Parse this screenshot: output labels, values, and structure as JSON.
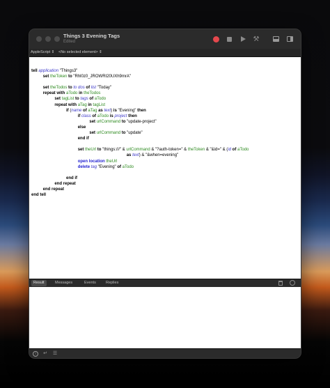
{
  "window": {
    "title": "Things 3 Evening Tags",
    "status": "Edited"
  },
  "toolbar": {
    "record_icon": "record-icon",
    "stop_icon": "stop-icon",
    "run_icon": "run-icon",
    "compile_icon": "hammer-icon",
    "colors": {
      "record": "#e5484d"
    }
  },
  "navbar": {
    "language": "AppleScript ⇕",
    "element": "<No selected element> ⇕"
  },
  "code": {
    "l1_a": "tell",
    "l1_b": "application",
    "l1_c": " \"Things3\"",
    "l2_a": "set",
    "l2_b": "theToken",
    "l2_c": "to",
    "l2_d": " \"Rhl0z0_JROWRI20UXh9mrA\"",
    "l4_a": "set",
    "l4_b": "theTodos",
    "l4_c": "to",
    "l4_d": "to dos",
    "l4_e": "of",
    "l4_f": "list",
    "l4_g": " \"Today\"",
    "l5_a": "repeat with",
    "l5_b": "aTodo",
    "l5_c": "in",
    "l5_d": "theTodos",
    "l6_a": "set",
    "l6_b": "tagList",
    "l6_c": "to",
    "l6_d": "tags",
    "l6_e": "of",
    "l6_f": "aTodo",
    "l7_a": "repeat with",
    "l7_b": "aTag",
    "l7_c": "in",
    "l7_d": "tagList",
    "l8_a": "if",
    "l8_b": " (",
    "l8_c": "name",
    "l8_d": "of",
    "l8_e": "aTag",
    "l8_f": "as",
    "l8_g": "text",
    "l8_h": ") ",
    "l8_i": "is",
    "l8_j": " \"Evening\" ",
    "l8_k": "then",
    "l9_a": "if",
    "l9_b": "class",
    "l9_c": "of",
    "l9_d": "aTodo",
    "l9_e": "is",
    "l9_f": "project",
    "l9_g": "then",
    "l10_a": "set",
    "l10_b": "urlCommand",
    "l10_c": "to",
    "l10_d": " \"update-project\"",
    "l11_a": "else",
    "l12_a": "set",
    "l12_b": "urlCommand",
    "l12_c": "to",
    "l12_d": " \"update\"",
    "l13_a": "end if",
    "l15_a": "set",
    "l15_b": "theUrl",
    "l15_c": "to",
    "l15_d": " \"things:///\" & ",
    "l15_e": "urlCommand",
    "l15_f": " & \"?auth-token=\" & ",
    "l15_g": "theToken",
    "l15_h": " & \"&id=\" & (",
    "l15_i": "id",
    "l15_j": "of",
    "l15_k": "aTodo",
    "l16_a": "as",
    "l16_b": "text",
    "l16_c": ") & \"&when=evening\"",
    "l17_a": "open location",
    "l17_b": "theUrl",
    "l18_a": "delete",
    "l18_b": "tag",
    "l18_c": " \"Evening\" ",
    "l18_d": "of",
    "l18_e": "aTodo",
    "l20_a": "end if",
    "l21_a": "end repeat",
    "l22_a": "end repeat",
    "l23_a": "end tell"
  },
  "tabs": {
    "result": "Result",
    "messages": "Messages",
    "events": "Events",
    "replies": "Replies"
  },
  "bottom": {
    "info_icon": "info-icon",
    "return_icon": "return-icon",
    "list_icon": "list-icon"
  }
}
